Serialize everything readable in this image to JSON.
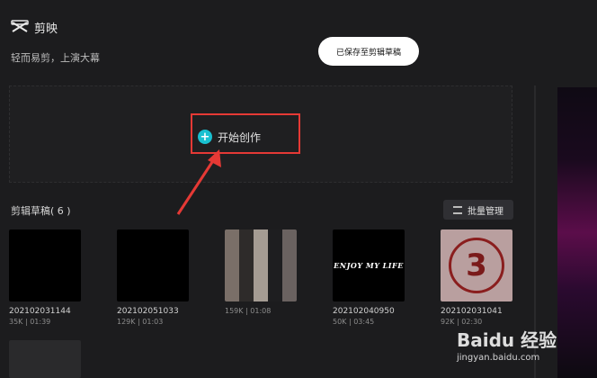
{
  "app": {
    "name": "剪映",
    "slogan": "轻而易剪，上演大幕"
  },
  "toast": {
    "text": "已保存至剪辑草稿"
  },
  "create": {
    "label": "开始创作"
  },
  "drafts": {
    "title": "剪辑草稿( 6 )",
    "batch_label": "批量管理",
    "items": [
      {
        "name": "202102031144",
        "meta": "35K | 01:39"
      },
      {
        "name": "202102051033",
        "meta": "129K | 01:03"
      },
      {
        "name": "",
        "meta": "159K | 01:08"
      },
      {
        "name": "202102040950",
        "meta": "50K | 03:45"
      },
      {
        "name": "202102031041",
        "meta": "92K | 02:30"
      }
    ],
    "enjoy_text": "ENJOY MY LIFE",
    "number_text": "3"
  },
  "watermark": {
    "logo": "Baidu 经验",
    "url": "jingyan.baidu.com"
  },
  "colors": {
    "accent": "#19c0d0",
    "highlight": "#e53935",
    "background": "#1c1c1e"
  }
}
